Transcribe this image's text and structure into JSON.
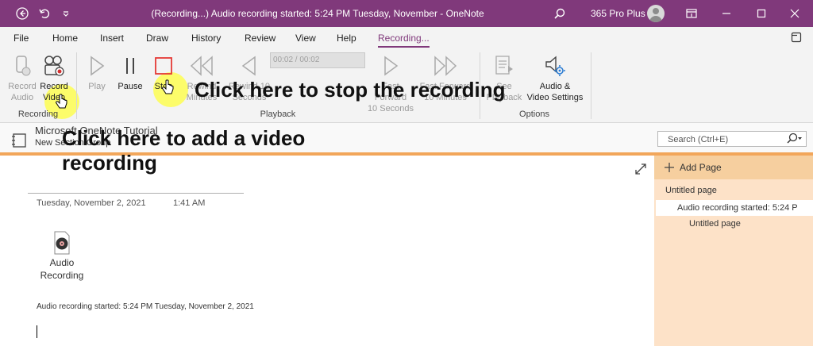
{
  "window": {
    "title": "(Recording...) Audio recording started: 5:24 PM Tuesday, November - OneNote",
    "user": "365 Pro Plus",
    "accent_color": "#80397b"
  },
  "menu": {
    "tabs": [
      "File",
      "Home",
      "Insert",
      "Draw",
      "History",
      "Review",
      "View",
      "Help",
      "Recording..."
    ]
  },
  "ribbon": {
    "record_audio": "Record Audio",
    "record_video_1": "Record",
    "record_video_2": "Video",
    "play": "Play",
    "pause": "Pause",
    "stop": "Stop",
    "rewind_10_min_1": "Rewind",
    "rewind_10_min_2": "Minutes",
    "rewind_10_sec_1": "Rewind 10",
    "rewind_10_sec_2": "Seconds",
    "time_display": "00:02 / 00:02",
    "forward_10_sec_1": "Fast Forward",
    "forward_10_sec_2": "10 Seconds",
    "forward_10_min_1": "Fast Forward",
    "forward_10_min_2": "10 Minutes",
    "see_playback_1": "See",
    "see_playback_2": "Playback",
    "audio_video_settings_1": "Audio &",
    "audio_video_settings_2": "Video Settings",
    "groups": {
      "recording": "Recording",
      "playback": "Playback",
      "options": "Options"
    }
  },
  "notebook": {
    "name": "Microsoft OneNote Tutorial",
    "section_group": "New Section Group",
    "search_placeholder": "Search (Ctrl+E)"
  },
  "page": {
    "date": "Tuesday, November 2, 2021",
    "time": "1:41 AM",
    "attachment_label_1": "Audio",
    "attachment_label_2": "Recording",
    "note": "Audio recording started: 5:24 PM Tuesday, November 2, 2021"
  },
  "pages_pane": {
    "add_page": "Add Page",
    "items": [
      "Untitled page",
      "Audio recording started: 5:24 P",
      "Untitled page"
    ]
  },
  "annotations": {
    "stop_caption": "Click here to stop the recording",
    "video_caption_1": "Click here to add a video",
    "video_caption_2": "recording"
  }
}
